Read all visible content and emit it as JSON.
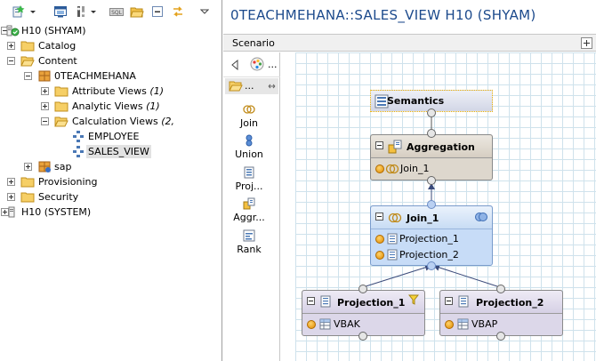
{
  "explorer": {
    "tree": [
      {
        "label": "H10 (SHYAM)",
        "count": ""
      },
      {
        "label": "Catalog",
        "count": ""
      },
      {
        "label": "Content",
        "count": ""
      },
      {
        "label": "0TEACHMEHANA",
        "count": ""
      },
      {
        "label": "Attribute Views",
        "count": "(1)"
      },
      {
        "label": "Analytic Views",
        "count": "(1)"
      },
      {
        "label": "Calculation Views",
        "count": "(2,"
      },
      {
        "label": "EMPLOYEE",
        "count": ""
      },
      {
        "label": "SALES_VIEW",
        "count": ""
      },
      {
        "label": "sap",
        "count": ""
      },
      {
        "label": "Provisioning",
        "count": ""
      },
      {
        "label": "Security",
        "count": ""
      },
      {
        "label": "H10 (SYSTEM)",
        "count": ""
      }
    ]
  },
  "editor": {
    "title": "0TEACHMEHANA::SALES_VIEW H10 (SHYAM)",
    "scenario_label": "Scenario",
    "palette": {
      "header_dots": "...",
      "top_dots": "...",
      "items": [
        {
          "label": "Join",
          "icon": "join-icon"
        },
        {
          "label": "Union",
          "icon": "union-icon"
        },
        {
          "label": "Proj...",
          "icon": "projection-icon"
        },
        {
          "label": "Aggr...",
          "icon": "aggregation-icon"
        },
        {
          "label": "Rank",
          "icon": "rank-icon"
        }
      ]
    },
    "nodes": {
      "semantics": {
        "name": "Semantics"
      },
      "aggregation": {
        "name": "Aggregation",
        "inputs": [
          "Join_1"
        ]
      },
      "join": {
        "name": "Join_1",
        "inputs": [
          "Projection_1",
          "Projection_2"
        ]
      },
      "projection1": {
        "name": "Projection_1",
        "inputs": [
          "VBAK"
        ]
      },
      "projection2": {
        "name": "Projection_2",
        "inputs": [
          "VBAP"
        ]
      }
    }
  },
  "colors": {
    "title": "#1c4a8c",
    "semantics_selected": "#f0b400",
    "aggregation_header": "#ddd7cd",
    "join_body": "#c7dcf7",
    "projection_body": "#dcd7e9",
    "grid": "#cfe2ec"
  }
}
